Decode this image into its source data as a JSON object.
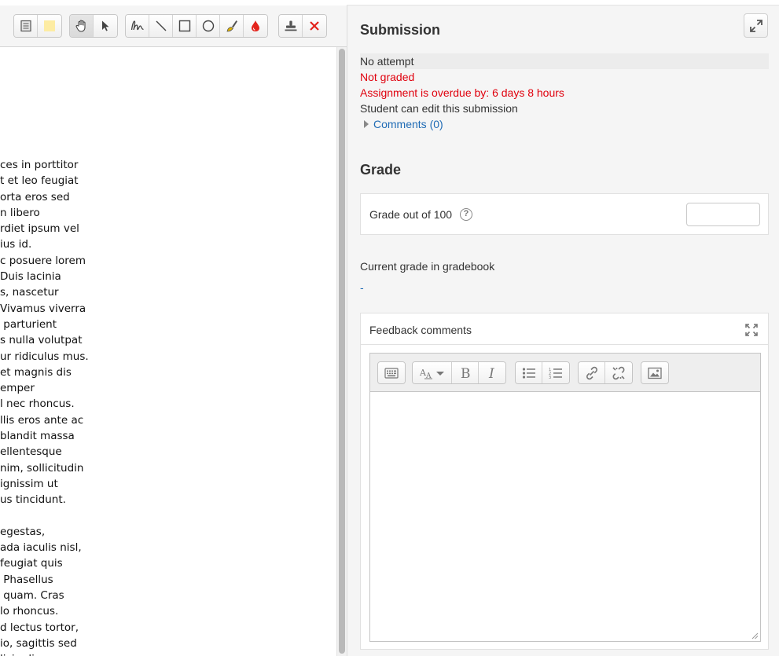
{
  "submission": {
    "heading": "Submission",
    "rows": [
      "No attempt",
      "Not graded",
      "Assignment is overdue by: 6 days 8 hours",
      "Student can edit this submission"
    ],
    "comments_link": "Comments (0)"
  },
  "grade": {
    "heading": "Grade",
    "label": "Grade out of 100",
    "help_glyph": "?",
    "value": ""
  },
  "gradebook": {
    "label": "Current grade in gradebook",
    "value": "-"
  },
  "feedback": {
    "label": "Feedback comments",
    "value": ""
  },
  "document": {
    "lines": [
      "ces in porttitor",
      "t et leo feugiat",
      "orta eros sed",
      "n libero",
      "rdiet ipsum vel",
      "ius id.",
      "c posuere lorem",
      "Duis lacinia",
      "s, nascetur",
      "Vivamus viverra",
      " parturient",
      "s nulla volutpat",
      "ur ridiculus mus.",
      "et magnis dis",
      "emper",
      "l nec rhoncus.",
      "llis eros ante ac",
      "blandit massa",
      "ellentesque",
      "nim, sollicitudin",
      "ignissim ut",
      "us tincidunt.",
      "",
      "egestas,",
      "ada iaculis nisl,",
      "feugiat quis",
      " Phasellus",
      " quam. Cras",
      "lo rhoncus.",
      "d lectus tortor,",
      "io, sagittis sed",
      "lici...di..."
    ]
  },
  "colors": {
    "accent_link": "#1f6bb5",
    "error_red": "#e0000d",
    "panel_bg": "#f5f5f5"
  },
  "icons": {
    "annotation_toolbar": [
      "comment-search-icon",
      "color-swatch-icon",
      "drag-hand-icon",
      "select-pointer-icon",
      "pen-icon",
      "line-icon",
      "rectangle-icon",
      "oval-icon",
      "highlighter-icon",
      "ink-color-icon",
      "stamp-icon",
      "stamp-cross-icon"
    ],
    "editor_toolbar": [
      "toolbar-toggle-icon",
      "font-size-icon",
      "bold-icon",
      "italic-icon",
      "unordered-list-icon",
      "ordered-list-icon",
      "link-icon",
      "unlink-icon",
      "image-icon"
    ]
  }
}
